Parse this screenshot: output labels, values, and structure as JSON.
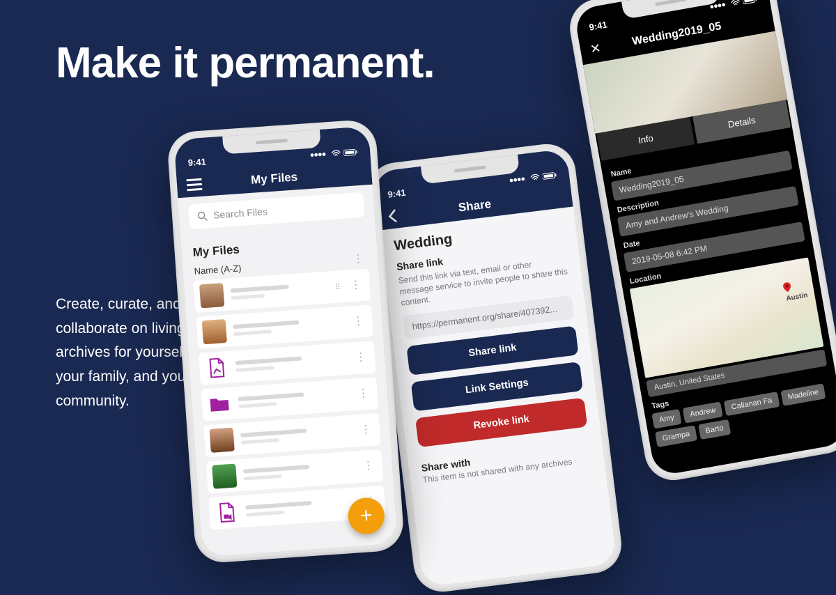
{
  "hero": {
    "title": "Make it permanent.",
    "body": "Create, curate, and collaborate on living archives for yourself, your family, and your community."
  },
  "status_time": "9:41",
  "phone1": {
    "title": "My Files",
    "search_placeholder": "Search Files",
    "section": "My Files",
    "sort": "Name (A-Z)"
  },
  "phone2": {
    "title": "Share",
    "item_name": "Wedding",
    "link_heading": "Share link",
    "link_help": "Send this link via text, email or other message service to invite people to share this content.",
    "url": "https://permanent.org/share/407392...",
    "btn_share": "Share link",
    "btn_settings": "Link Settings",
    "btn_revoke": "Revoke link",
    "share_with_heading": "Share with",
    "share_with_body": "This item is not shared with any archives"
  },
  "phone3": {
    "title": "Wedding2019_05",
    "tab_info": "Info",
    "tab_details": "Details",
    "name_label": "Name",
    "name_value": "Wedding2019_05",
    "desc_label": "Description",
    "desc_value": "Amy and Andrew's Wedding",
    "date_label": "Date",
    "date_value": "2019-05-08 6:42 PM",
    "location_label": "Location",
    "location_value": "Austin, United States",
    "map_city": "Austin",
    "tags_label": "Tags",
    "tags": [
      "Amy",
      "Andrew",
      "Callanan Fa",
      "Madeline",
      "Grampa",
      "Barto"
    ]
  }
}
